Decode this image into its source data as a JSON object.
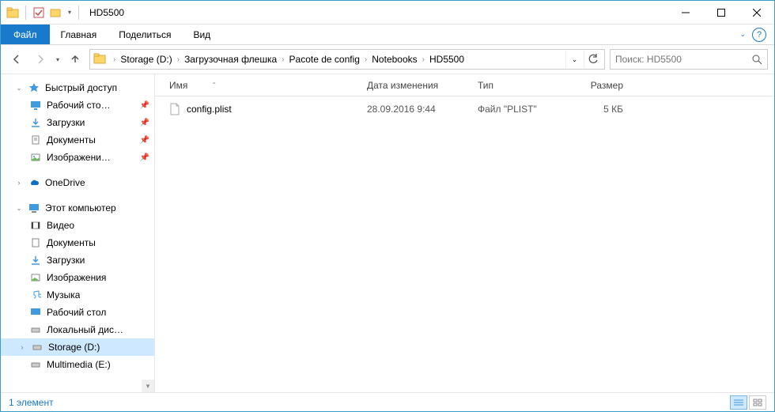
{
  "window": {
    "title": "HD5500"
  },
  "ribbon": {
    "file": "Файл",
    "tabs": [
      "Главная",
      "Поделиться",
      "Вид"
    ]
  },
  "breadcrumbs": [
    "Storage (D:)",
    "Загрузочная флешка",
    "Pacote de config",
    "Notebooks",
    "HD5500"
  ],
  "search": {
    "placeholder": "Поиск: HD5500"
  },
  "sidebar": {
    "quickaccess": {
      "label": "Быстрый доступ",
      "items": [
        {
          "label": "Рабочий сто…",
          "pinned": true
        },
        {
          "label": "Загрузки",
          "pinned": true
        },
        {
          "label": "Документы",
          "pinned": true
        },
        {
          "label": "Изображени…",
          "pinned": true
        }
      ]
    },
    "onedrive": {
      "label": "OneDrive"
    },
    "thispc": {
      "label": "Этот компьютер",
      "items": [
        {
          "label": "Видео"
        },
        {
          "label": "Документы"
        },
        {
          "label": "Загрузки"
        },
        {
          "label": "Изображения"
        },
        {
          "label": "Музыка"
        },
        {
          "label": "Рабочий стол"
        },
        {
          "label": "Локальный дис…"
        },
        {
          "label": "Storage (D:)",
          "selected": true
        },
        {
          "label": "Multimedia (E:)"
        }
      ]
    }
  },
  "columns": {
    "name": "Имя",
    "date": "Дата изменения",
    "type": "Тип",
    "size": "Размер"
  },
  "files": [
    {
      "name": "config.plist",
      "date": "28.09.2016 9:44",
      "type": "Файл \"PLIST\"",
      "size": "5 КБ"
    }
  ],
  "status": {
    "count": "1 элемент"
  }
}
